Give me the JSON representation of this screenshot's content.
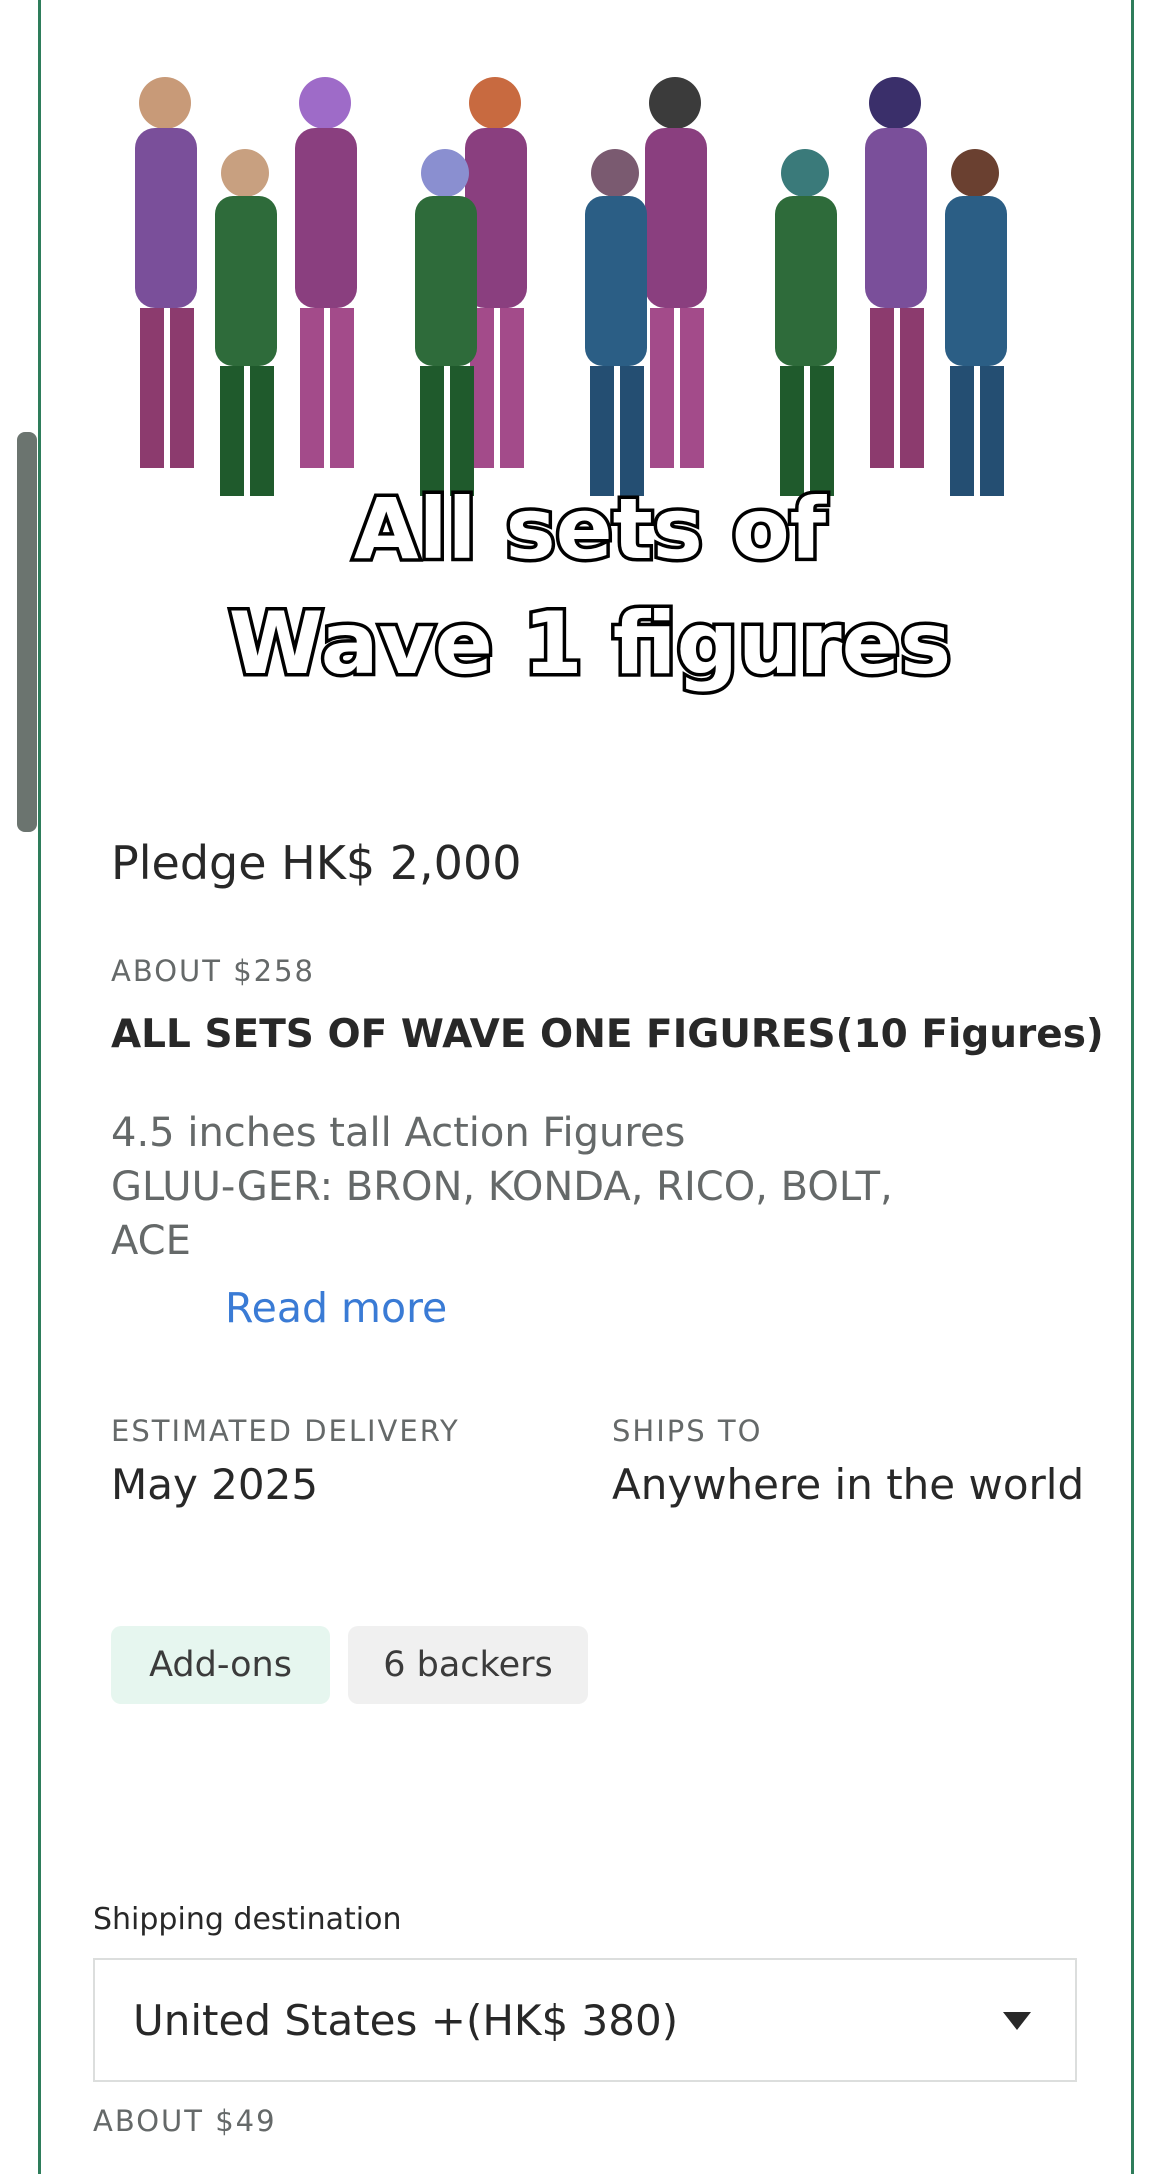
{
  "reward": {
    "image_caption_line1": "All sets of",
    "image_caption_line2": "Wave 1 figures",
    "pledge": "Pledge HK$ 2,000",
    "about": "ABOUT $258",
    "name": "ALL SETS OF WAVE ONE FIGURES(10 Figures)",
    "description_line1": "4.5 inches tall Action Figures",
    "description_line2": "GLUU-GER: BRON, KONDA, RICO, BOLT,",
    "description_line3": "ACE",
    "read_more": "Read more"
  },
  "delivery": {
    "estimated_label": "ESTIMATED DELIVERY",
    "estimated_value": "May 2025",
    "ships_label": "SHIPS TO",
    "ships_value": "Anywhere in the world"
  },
  "badges": {
    "addons": "Add-ons",
    "backers": "6 backers"
  },
  "shipping": {
    "label": "Shipping destination",
    "selected": "United States +(HK$ 380)",
    "about": "ABOUT $49"
  },
  "colors": {
    "accent_border": "#2e7d5b",
    "link": "#3a7bd5",
    "addons_bg": "#e6f6ef",
    "backers_bg": "#f0f0f0"
  }
}
